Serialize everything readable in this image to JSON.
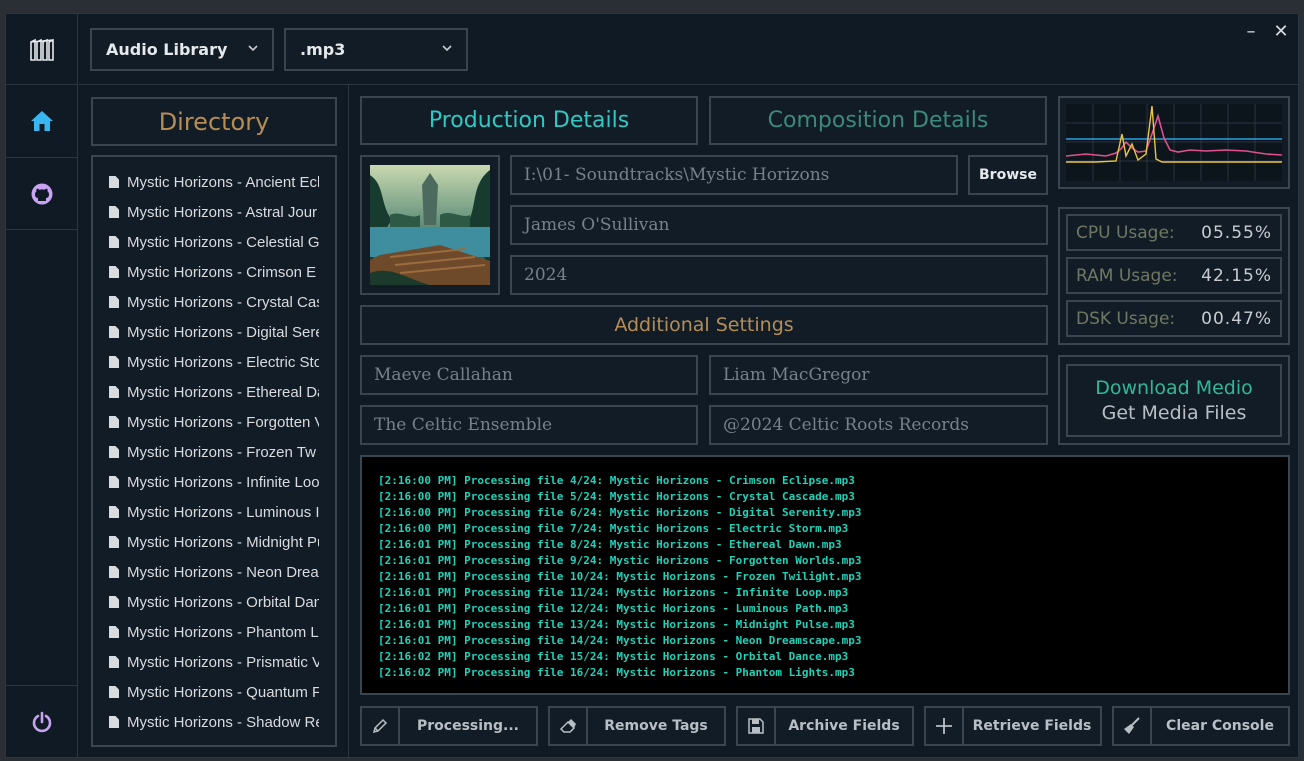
{
  "nav": {
    "logo_icon": "logo-icon",
    "items": [
      {
        "name": "home",
        "icon": "home-icon"
      },
      {
        "name": "github",
        "icon": "github-icon"
      }
    ],
    "power_icon": "power-icon"
  },
  "toolbar": {
    "library_select": "Audio Library",
    "format_select": ".mp3",
    "minimize": "–",
    "close": "✕"
  },
  "directory": {
    "title": "Directory",
    "files": [
      "Mystic Horizons - Ancient Ecl",
      "Mystic Horizons - Astral Jour",
      "Mystic Horizons - Celestial G",
      "Mystic Horizons - Crimson E",
      "Mystic Horizons - Crystal Cas",
      "Mystic Horizons - Digital Sere",
      "Mystic Horizons - Electric Sto",
      "Mystic Horizons - Ethereal Da",
      "Mystic Horizons - Forgotten V",
      "Mystic Horizons - Frozen Tw",
      "Mystic Horizons - Infinite Loo",
      "Mystic Horizons - Luminous I",
      "Mystic Horizons - Midnight Pu",
      "Mystic Horizons - Neon Drea",
      "Mystic Horizons - Orbital Dan",
      "Mystic Horizons - Phantom L",
      "Mystic Horizons - Prismatic V",
      "Mystic Horizons - Quantum F",
      "Mystic Horizons - Shadow Re"
    ]
  },
  "tabs": {
    "production": "Production Details",
    "composition": "Composition Details"
  },
  "production": {
    "path": "I:\\01- Soundtracks\\Mystic Horizons",
    "browse_label": "Browse",
    "artist": "James O'Sullivan",
    "year": "2024"
  },
  "additional": {
    "title": "Additional Settings",
    "field1": "Maeve Callahan",
    "field2": "Liam MacGregor",
    "field3": "The Celtic Ensemble",
    "field4": "@2024 Celtic Roots Records"
  },
  "stats": {
    "cpu_label": "CPU Usage:",
    "cpu_value": "05.55%",
    "ram_label": "RAM Usage:",
    "ram_value": "42.15%",
    "dsk_label": "DSK Usage:",
    "dsk_value": "00.47%"
  },
  "download": {
    "line1": "Download Medio",
    "line2": "Get Media Files"
  },
  "console": {
    "lines": [
      "[2:16:00 PM] Processing file 4/24: Mystic Horizons - Crimson Eclipse.mp3",
      "[2:16:00 PM] Processing file 5/24: Mystic Horizons - Crystal Cascade.mp3",
      "[2:16:00 PM] Processing file 6/24: Mystic Horizons - Digital Serenity.mp3",
      "[2:16:00 PM] Processing file 7/24: Mystic Horizons - Electric Storm.mp3",
      "[2:16:01 PM] Processing file 8/24: Mystic Horizons - Ethereal Dawn.mp3",
      "[2:16:01 PM] Processing file 9/24: Mystic Horizons - Forgotten Worlds.mp3",
      "[2:16:01 PM] Processing file 10/24: Mystic Horizons - Frozen Twilight.mp3",
      "[2:16:01 PM] Processing file 11/24: Mystic Horizons - Infinite Loop.mp3",
      "[2:16:01 PM] Processing file 12/24: Mystic Horizons - Luminous Path.mp3",
      "[2:16:01 PM] Processing file 13/24: Mystic Horizons - Midnight Pulse.mp3",
      "[2:16:01 PM] Processing file 14/24: Mystic Horizons - Neon Dreamscape.mp3",
      "[2:16:02 PM] Processing file 15/24: Mystic Horizons - Orbital Dance.mp3",
      "[2:16:02 PM] Processing file 16/24: Mystic Horizons - Phantom Lights.mp3"
    ]
  },
  "buttons": {
    "processing": "Processing...",
    "remove_tags": "Remove Tags",
    "archive_fields": "Archive Fields",
    "retrieve_fields": "Retrieve Fields",
    "clear_console": "Clear Console"
  },
  "colors": {
    "accent_teal": "#2fc9c4",
    "accent_teal_dim": "#3a8a7c",
    "accent_gold": "#b58d55",
    "nav_icon": "#c7a3f2",
    "console_text": "#1fd1b9",
    "background": "#101a24"
  }
}
